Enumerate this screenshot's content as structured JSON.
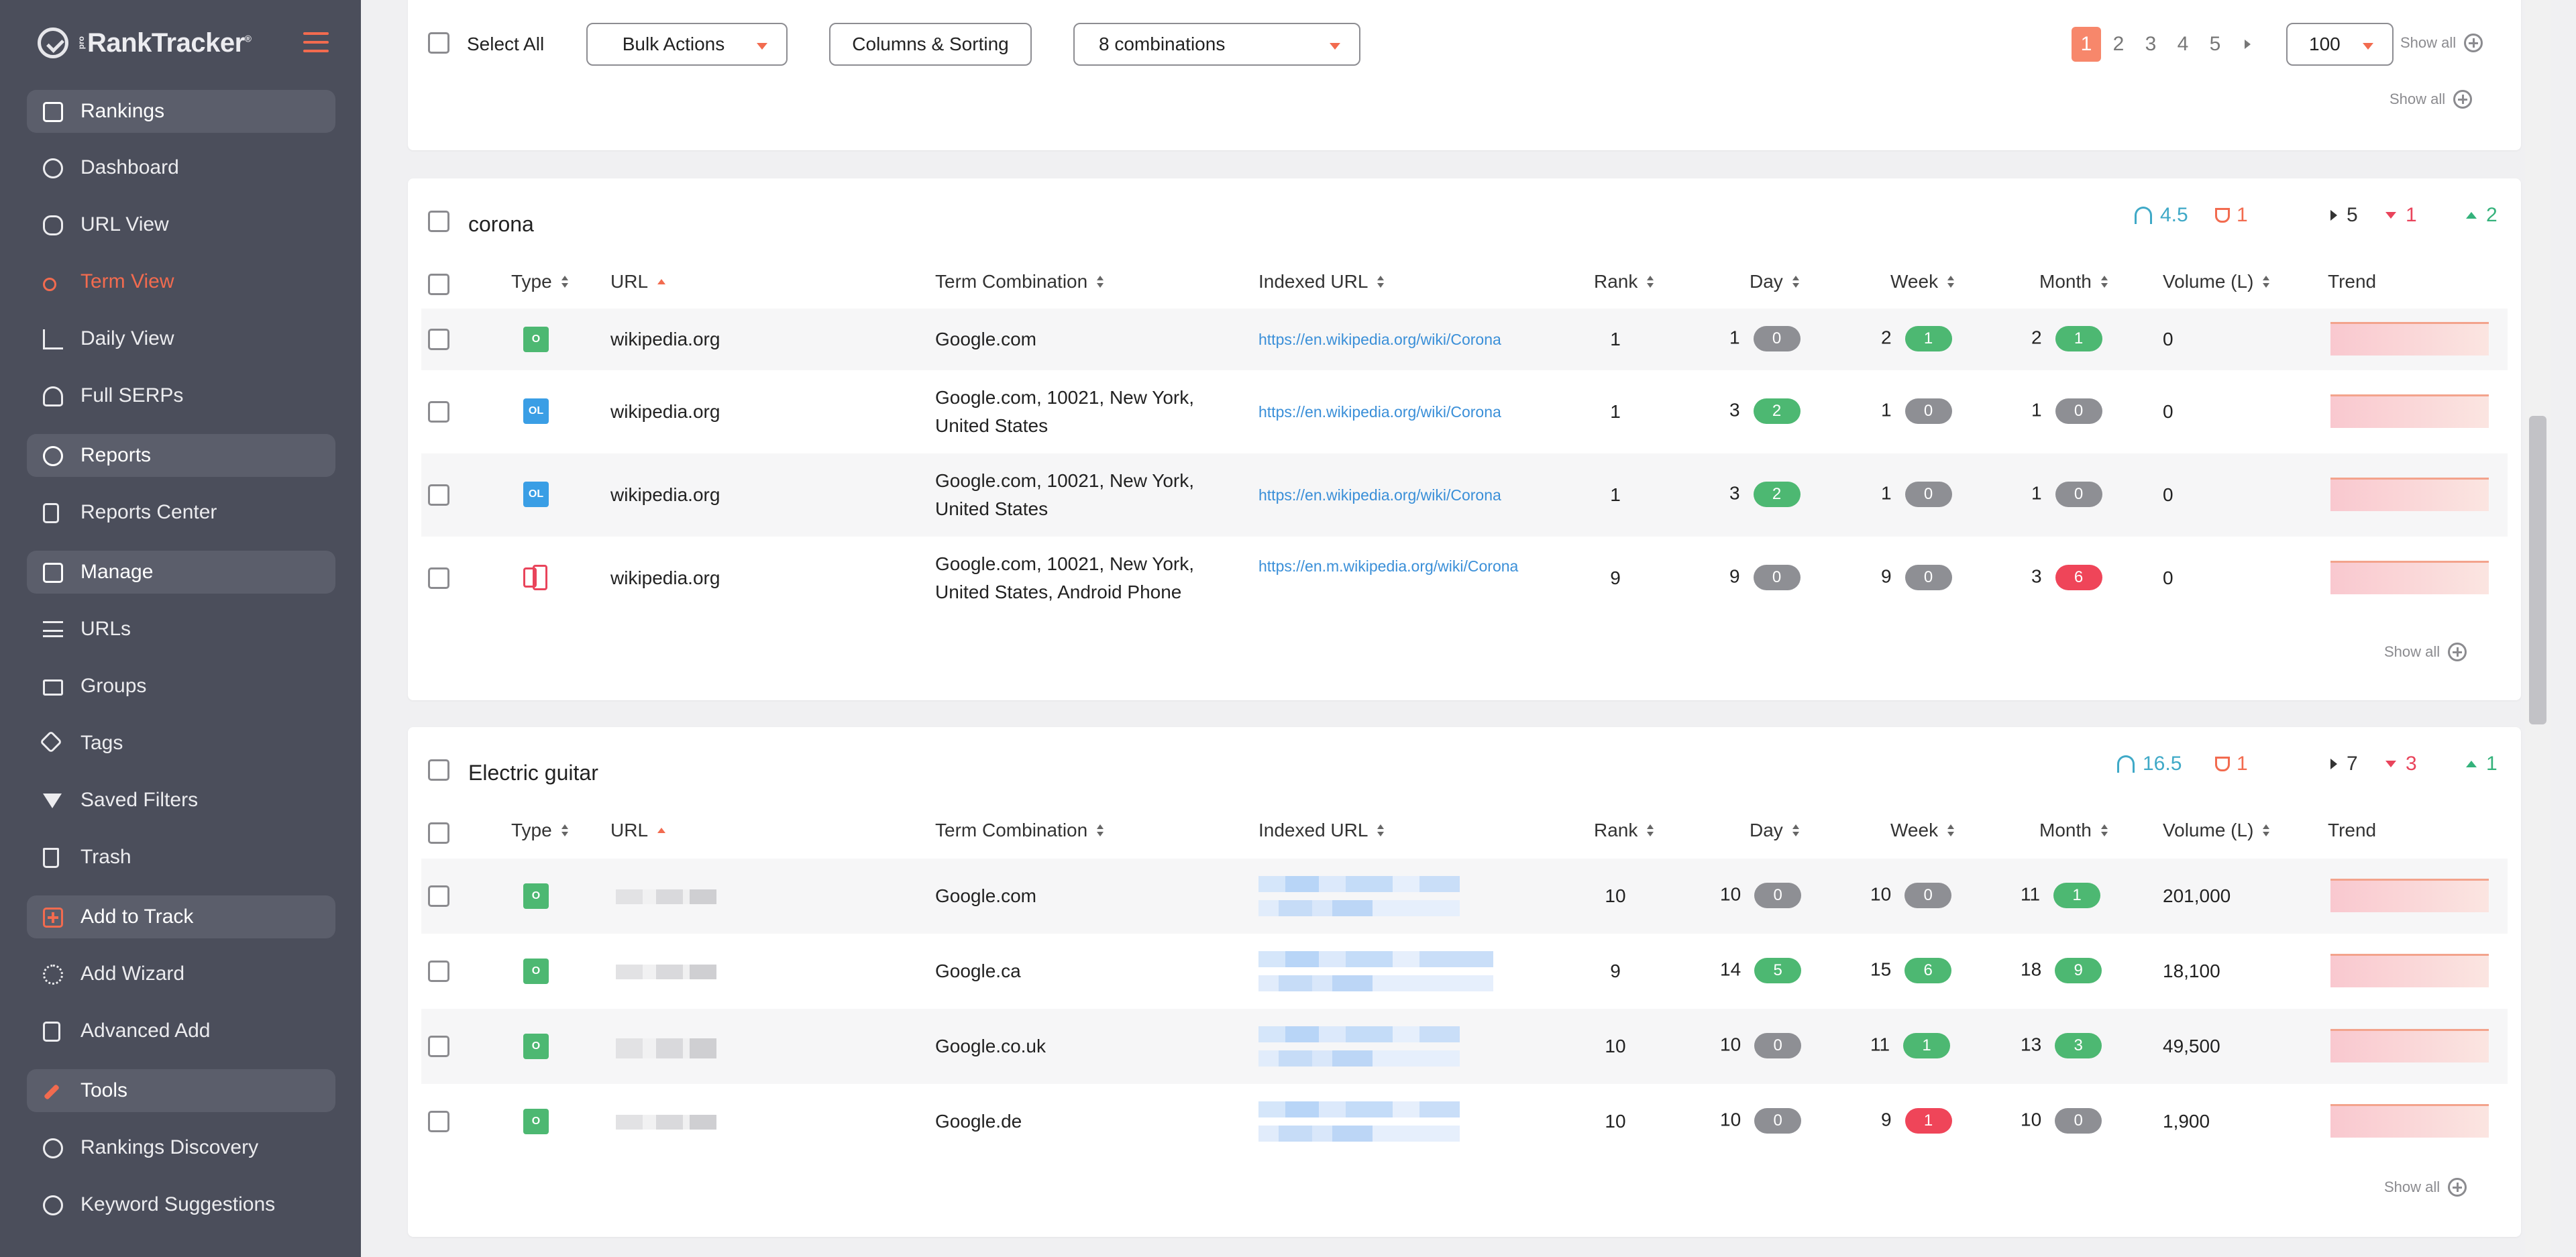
{
  "brand": {
    "name": "RankTracker",
    "tm": "®",
    "small": "pro"
  },
  "sidebar": {
    "items": [
      {
        "label": "Rankings",
        "icon": "rankings-icon",
        "section": true
      },
      {
        "label": "Dashboard",
        "icon": "dashboard-icon"
      },
      {
        "label": "URL View",
        "icon": "link-icon"
      },
      {
        "label": "Term View",
        "icon": "key-icon",
        "active": true
      },
      {
        "label": "Daily View",
        "icon": "line-chart-icon"
      },
      {
        "label": "Full SERPs",
        "icon": "serp-icon"
      },
      {
        "label": "Reports",
        "icon": "pie-chart-icon",
        "section": true
      },
      {
        "label": "Reports Center",
        "icon": "document-icon"
      },
      {
        "label": "Manage",
        "icon": "edit-icon",
        "section": true
      },
      {
        "label": "URLs",
        "icon": "list-icon"
      },
      {
        "label": "Groups",
        "icon": "folder-icon"
      },
      {
        "label": "Tags",
        "icon": "tag-icon"
      },
      {
        "label": "Saved Filters",
        "icon": "filter-icon"
      },
      {
        "label": "Trash",
        "icon": "trash-icon"
      },
      {
        "label": "Add to Track",
        "icon": "add-box-icon",
        "section": true
      },
      {
        "label": "Add Wizard",
        "icon": "wizard-icon"
      },
      {
        "label": "Advanced Add",
        "icon": "clipboard-plus-icon"
      },
      {
        "label": "Tools",
        "icon": "tools-icon",
        "section": true
      },
      {
        "label": "Rankings Discovery",
        "icon": "globe-icon"
      },
      {
        "label": "Keyword Suggestions",
        "icon": "search-icon"
      }
    ]
  },
  "toolbar": {
    "select_all": "Select All",
    "bulk_actions": "Bulk Actions",
    "columns_sorting": "Columns & Sorting",
    "combinations": "8 combinations",
    "pages": [
      "1",
      "2",
      "3",
      "4",
      "5"
    ],
    "per_page": "100",
    "show_all": "Show all"
  },
  "columns": {
    "type": "Type",
    "url": "URL",
    "term": "Term Combination",
    "indexed": "Indexed URL",
    "rank": "Rank",
    "day": "Day",
    "week": "Week",
    "month": "Month",
    "volume": "Volume (L)",
    "trend": "Trend"
  },
  "groups": [
    {
      "title": "corona",
      "stats": {
        "avg": "4.5",
        "top": "1",
        "same": "5",
        "down": "1",
        "up": "2"
      },
      "show_all": "Show all",
      "rows": [
        {
          "type": "O",
          "url": "wikipedia.org",
          "term": "Google.com",
          "indexed": "https://en.wikipedia.org/wiki/Corona",
          "rank": "1",
          "day": "1",
          "day_chg": "0",
          "week": "2",
          "week_chg": "1",
          "month": "2",
          "month_chg": "1",
          "volume": "0"
        },
        {
          "type": "OL",
          "url": "wikipedia.org",
          "term": "Google.com, 10021, New York, United States",
          "indexed": "https://en.wikipedia.org/wiki/Corona",
          "rank": "1",
          "day": "3",
          "day_chg": "2",
          "week": "1",
          "week_chg": "0",
          "month": "1",
          "month_chg": "0",
          "volume": "0"
        },
        {
          "type": "OL",
          "url": "wikipedia.org",
          "term": "Google.com, 10021, New York, United States",
          "indexed": "https://en.wikipedia.org/wiki/Corona",
          "rank": "1",
          "day": "3",
          "day_chg": "2",
          "week": "1",
          "week_chg": "0",
          "month": "1",
          "month_chg": "0",
          "volume": "0"
        },
        {
          "type": "phone",
          "url": "wikipedia.org",
          "term": "Google.com, 10021, New York, United States, Android Phone",
          "indexed": "https://en.m.wikipedia.org/wiki/Corona",
          "rank": "9",
          "day": "9",
          "day_chg": "0",
          "week": "9",
          "week_chg": "0",
          "month": "3",
          "month_chg": "6",
          "volume": "0"
        }
      ]
    },
    {
      "title": "Electric guitar",
      "stats": {
        "avg": "16.5",
        "top": "1",
        "same": "7",
        "down": "3",
        "up": "1"
      },
      "show_all": "Show all",
      "rows": [
        {
          "type": "O",
          "term": "Google.com",
          "rank": "10",
          "day": "10",
          "day_chg": "0",
          "week": "10",
          "week_chg": "0",
          "month": "11",
          "month_chg": "1",
          "volume": "201,000"
        },
        {
          "type": "O",
          "term": "Google.ca",
          "rank": "9",
          "day": "14",
          "day_chg": "5",
          "week": "15",
          "week_chg": "6",
          "month": "18",
          "month_chg": "9",
          "volume": "18,100"
        },
        {
          "type": "O",
          "term": "Google.co.uk",
          "rank": "10",
          "day": "10",
          "day_chg": "0",
          "week": "11",
          "week_chg": "1",
          "month": "13",
          "month_chg": "3",
          "volume": "49,500"
        },
        {
          "type": "O",
          "term": "Google.de",
          "rank": "10",
          "day": "10",
          "day_chg": "0",
          "week": "9",
          "week_chg": "1",
          "month": "10",
          "month_chg": "0",
          "volume": "1,900"
        }
      ]
    }
  ],
  "colors": {
    "accent": "#f26b4f",
    "sidebar_bg": "#4b4e5b",
    "chg_green": "#4db872",
    "chg_red": "#ef4559",
    "chg_gray": "#8e8f94",
    "link": "#3a8fd8"
  }
}
